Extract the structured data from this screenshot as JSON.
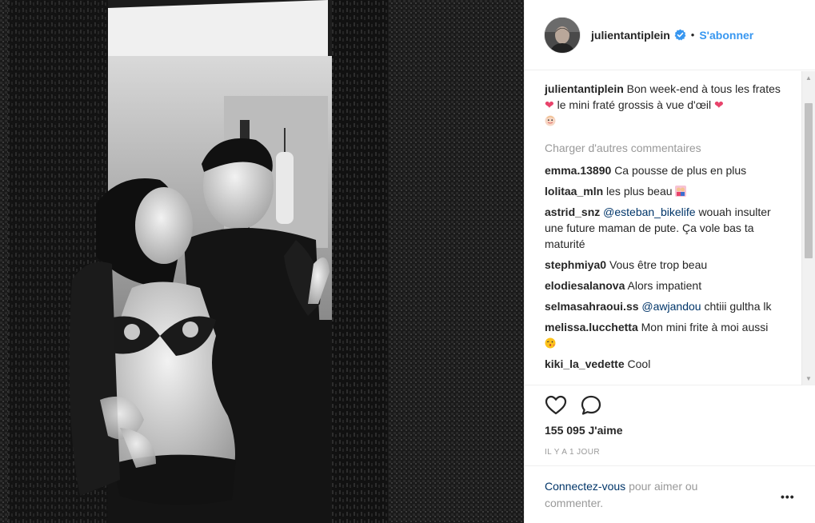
{
  "post": {
    "username": "julientantiplein",
    "follow_label": "S'abonner",
    "separator": "•",
    "caption_user": "julientantiplein",
    "caption_text_1": "Bon week-end à tous les frates",
    "caption_text_2": "le mini fraté grossis à vue d'œil",
    "load_more": "Charger d'autres commentaires",
    "likes": "155 095 J'aime",
    "timestamp": "IL Y A 1 JOUR"
  },
  "comments": [
    {
      "user": "emma.13890",
      "text": "Ca pousse de plus en plus"
    },
    {
      "user": "lolitaa_mln",
      "text": "les plus beau"
    },
    {
      "user": "astrid_snz",
      "mention": "@esteban_bikelife",
      "text": "wouah insulter une future maman de pute. Ça vole bas ta maturité"
    },
    {
      "user": "stephmiya0",
      "text": "Vous être trop beau"
    },
    {
      "user": "elodiesalanova",
      "text": "Alors impatient"
    },
    {
      "user": "selmasahraoui.ss",
      "mention": "@awjandou",
      "text": "chtiii gultha lk"
    },
    {
      "user": "melissa.lucchetta",
      "text": "Mon mini frite à moi aussi"
    },
    {
      "user": "kiki_la_vedette",
      "text": "Cool"
    }
  ],
  "footer": {
    "login_link": "Connectez-vous",
    "login_rest": "pour aimer ou commenter.",
    "more": "•••"
  },
  "icons": {
    "verified": "verified-badge-icon",
    "like": "heart-outline-icon",
    "comment": "comment-bubble-icon"
  },
  "colors": {
    "link_blue": "#3897f0",
    "muted": "#999999",
    "heart_red": "#e8436b"
  }
}
